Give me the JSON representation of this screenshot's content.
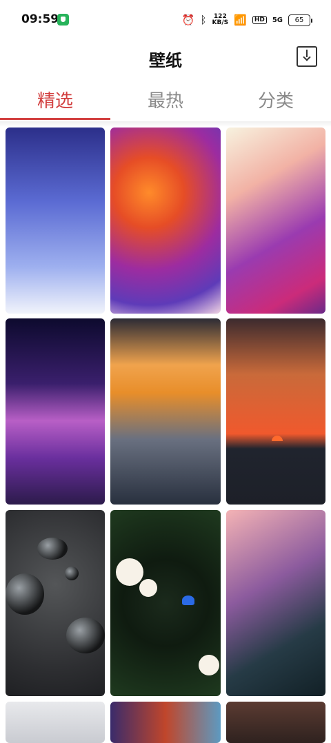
{
  "status_bar": {
    "time": "09:59",
    "network_speed": "122\nKB/S",
    "hd_label": "HD",
    "signal_label": "5G",
    "battery": "65"
  },
  "header": {
    "title": "壁纸",
    "download_icon": "download-icon"
  },
  "tabs": [
    {
      "label": "精选",
      "active": true
    },
    {
      "label": "最热",
      "active": false
    },
    {
      "label": "分类",
      "active": false
    }
  ],
  "colors": {
    "accent": "#d23f3f",
    "tab_inactive": "#8a8a8a",
    "background": "#ffffff"
  },
  "wallpapers": [
    {
      "name": "blue-gradient"
    },
    {
      "name": "fluid-orange-purple"
    },
    {
      "name": "fluid-pink-purple"
    },
    {
      "name": "purple-night-sky"
    },
    {
      "name": "sunset-clouds"
    },
    {
      "name": "ocean-sunset"
    },
    {
      "name": "water-drops"
    },
    {
      "name": "tropical-leaves-flowers"
    },
    {
      "name": "bird-of-paradise"
    },
    {
      "name": "light-gray"
    },
    {
      "name": "colorful-waves"
    },
    {
      "name": "brown-abstract"
    }
  ]
}
